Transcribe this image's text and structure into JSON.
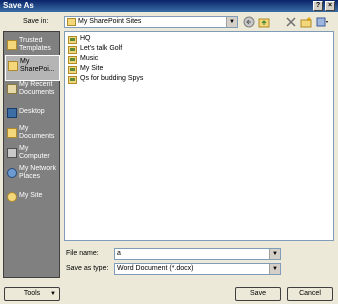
{
  "window": {
    "title": "Save As",
    "help": "?",
    "close": "×"
  },
  "save_in": {
    "label": "Save in:",
    "value": "My SharePoint Sites"
  },
  "places": [
    {
      "label": "Trusted Templates"
    },
    {
      "label": "My SharePoi..."
    },
    {
      "label": "My Recent Documents"
    },
    {
      "label": "Desktop"
    },
    {
      "label": "My Documents"
    },
    {
      "label": "My Computer"
    },
    {
      "label": "My Network Places"
    },
    {
      "label": "My Site"
    }
  ],
  "files": [
    {
      "name": "HQ"
    },
    {
      "name": "Let's talk Golf"
    },
    {
      "name": "Music"
    },
    {
      "name": "My Site"
    },
    {
      "name": "Qs for budding Spys"
    }
  ],
  "file_name": {
    "label": "File name:",
    "value": "a"
  },
  "save_as_type": {
    "label": "Save as type:",
    "value": "Word Document (*.docx)"
  },
  "buttons": {
    "tools": "Tools",
    "save": "Save",
    "cancel": "Cancel"
  },
  "icons": [
    "back-icon",
    "up-folder-icon",
    "delete-icon",
    "new-folder-icon",
    "views-icon"
  ]
}
